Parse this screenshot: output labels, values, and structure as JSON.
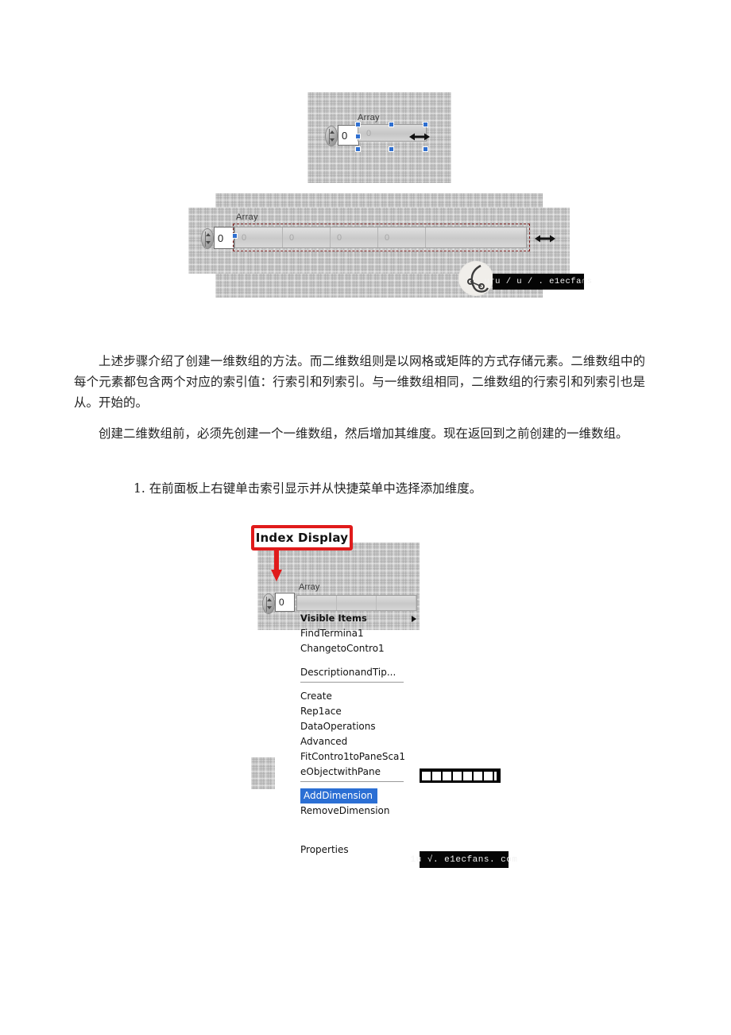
{
  "document": {
    "paragraphs": [
      "上述步骤介绍了创建一维数组的方法。而二维数组则是以网格或矩阵的方式存储元素。二维数组中的每个元素都包含两个对应的索引值：行索引和列索引。与一维数组相同，二维数组的行索引和列索引也是从。开始的。",
      "创建二维数组前，必须先创建一个一维数组，然后增加其维度。现在返回到之前创建的一维数组。",
      "1. 在前面板上右键单击索引显示并从快捷菜单中选择添加维度。"
    ]
  },
  "figure1": {
    "array_label": "Array",
    "index_value": "0",
    "element_value": "0",
    "resize_icon": "horizontal-resize-icon"
  },
  "figure2": {
    "array_label": "Array",
    "index_value": "0",
    "cells": [
      "0",
      "0",
      "0",
      "0",
      ""
    ],
    "resize_icon": "horizontal-resize-icon",
    "watermark": "uru / u / . e1ecfa∩s"
  },
  "figure3": {
    "callout_label": "Index Display",
    "array_label": "Array",
    "index_value": "0",
    "context_menu": [
      {
        "label": "Visible Items",
        "type": "header",
        "submenu": true
      },
      {
        "label": "FindTermina1",
        "type": "item"
      },
      {
        "label": "ChangetoContro1",
        "type": "item"
      },
      {
        "label": "DescriptionandTip...",
        "type": "item-underlined"
      },
      {
        "label": "Create",
        "type": "item"
      },
      {
        "label": "Rep1ace",
        "type": "item"
      },
      {
        "label": "DataOperations",
        "type": "item"
      },
      {
        "label": "Advanced",
        "type": "item"
      },
      {
        "label": "FitContro1toPaneSca1",
        "type": "item"
      },
      {
        "label": "eObjectwithPane",
        "type": "item-underlined"
      },
      {
        "label": "AddDimension",
        "type": "selected"
      },
      {
        "label": "RemoveDimension",
        "type": "item"
      },
      {
        "label": "Properties",
        "type": "item"
      }
    ],
    "watermark": "1u √. e1ecfans. com"
  },
  "colors": {
    "callout_border": "#e01b1b",
    "menu_selection": "#2b6fd4",
    "panel_gray": "#c9c9c9",
    "array_border_dashed": "#7a1c1c",
    "selection_handle": "#2f6fd0"
  }
}
